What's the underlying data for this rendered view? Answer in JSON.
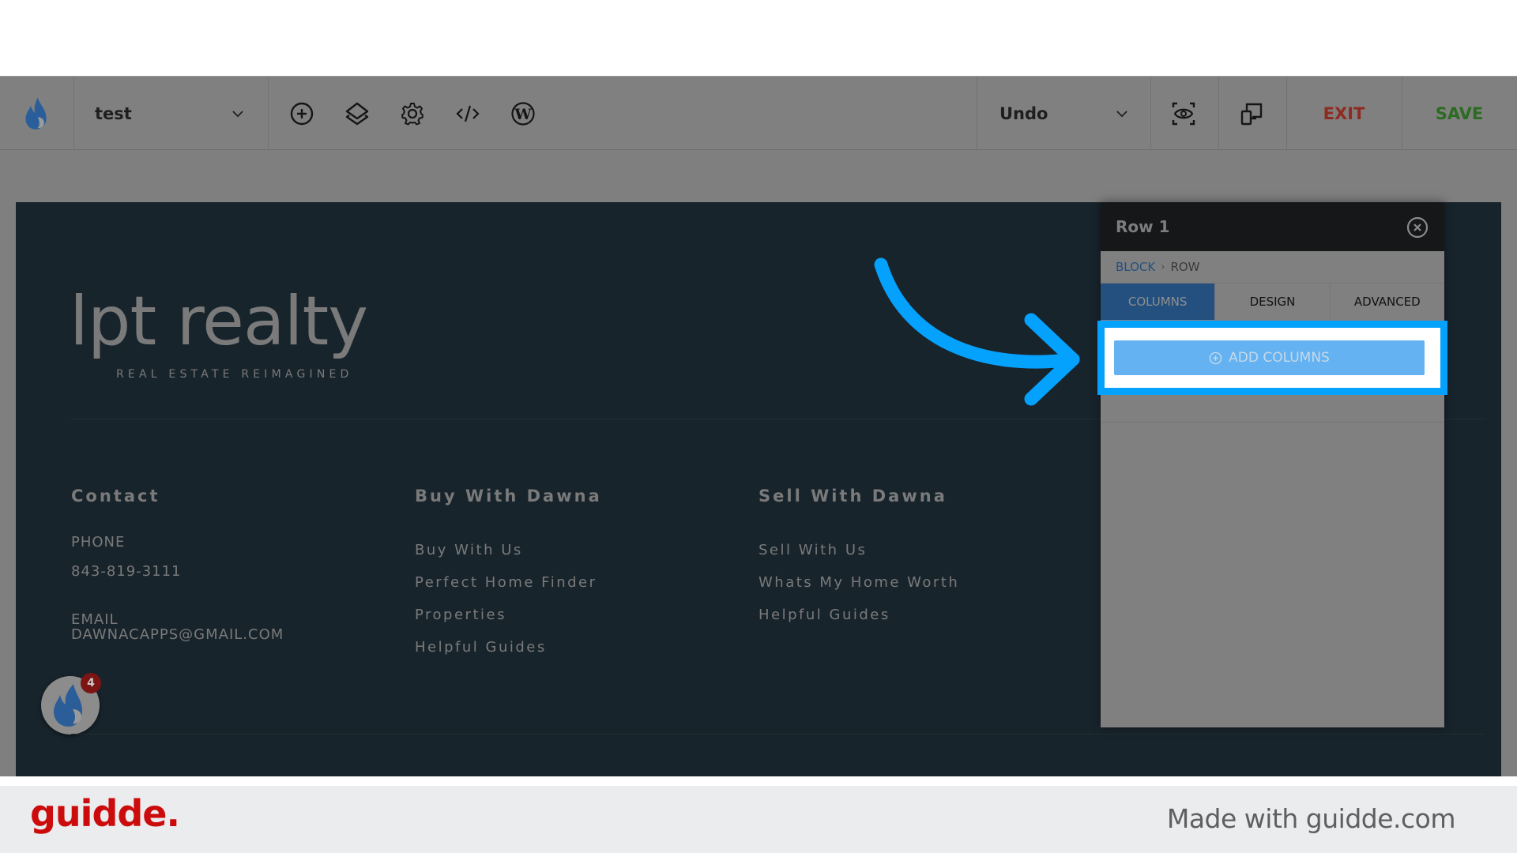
{
  "toolbar": {
    "page_selector": {
      "value": "test"
    },
    "icons": [
      "add-element",
      "layers",
      "settings",
      "code",
      "wordpress"
    ],
    "undo_selector": {
      "value": "Undo"
    },
    "preview_icon": "preview-eye",
    "responsive_icon": "responsive-devices",
    "exit_label": "EXIT",
    "save_label": "SAVE",
    "colors": {
      "exit": "#8f2a20",
      "save": "#2c6b22"
    }
  },
  "site": {
    "logo": {
      "main": "lpt realty",
      "tagline": "REAL ESTATE REIMAGINED"
    },
    "columns": [
      {
        "heading": "Contact",
        "phone_label": "PHONE",
        "phone_value": "843-819-3111",
        "email_label": "EMAIL",
        "email_value": "DAWNACAPPS@GMAIL.COM"
      },
      {
        "heading": "Buy With Dawna",
        "links": [
          "Buy With Us",
          "Perfect Home Finder",
          "Properties",
          "Helpful Guides"
        ]
      },
      {
        "heading": "Sell With Dawna",
        "links": [
          "Sell With Us",
          "Whats My Home Worth",
          "Helpful Guides"
        ]
      }
    ],
    "chat_widget": {
      "badge_count": "4"
    }
  },
  "panel": {
    "title": "Row 1",
    "breadcrumb": [
      "BLOCK",
      "ROW"
    ],
    "tabs": [
      {
        "label": "COLUMNS",
        "active": true
      },
      {
        "label": "DESIGN",
        "active": false
      },
      {
        "label": "ADVANCED",
        "active": false
      }
    ],
    "add_columns_label": "ADD COLUMNS"
  },
  "annotation": {
    "highlight_color": "#04a1fd"
  },
  "footer": {
    "brand": "guidde.",
    "made_with": "Made with guidde.com",
    "brand_color": "#cc0c0c"
  }
}
